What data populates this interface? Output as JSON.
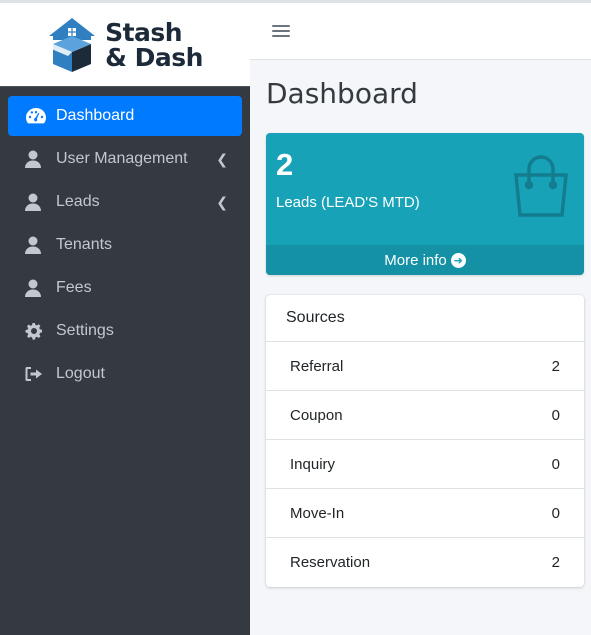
{
  "brand": {
    "line1": "Stash",
    "line2": "& Dash"
  },
  "sidebar": {
    "items": [
      {
        "label": "Dashboard"
      },
      {
        "label": "User Management"
      },
      {
        "label": "Leads"
      },
      {
        "label": "Tenants"
      },
      {
        "label": "Fees"
      },
      {
        "label": "Settings"
      },
      {
        "label": "Logout"
      }
    ]
  },
  "main": {
    "title": "Dashboard",
    "stat": {
      "count": "2",
      "label": "Leads (LEAD'S MTD)",
      "more": "More info"
    },
    "sources": {
      "title": "Sources",
      "rows": [
        {
          "name": "Referral",
          "value": "2"
        },
        {
          "name": "Coupon",
          "value": "0"
        },
        {
          "name": "Inquiry",
          "value": "0"
        },
        {
          "name": "Move-In",
          "value": "0"
        },
        {
          "name": "Reservation",
          "value": "2"
        }
      ]
    }
  },
  "colors": {
    "accent": "#007bff",
    "sidebar": "#343a40",
    "info": "#17a2b8"
  },
  "icons": [
    "dashboard-icon",
    "user-icon",
    "gear-icon",
    "logout-icon",
    "shopping-bag-icon",
    "arrow-circle-right-icon",
    "hamburger-icon",
    "chevron-left-icon"
  ]
}
